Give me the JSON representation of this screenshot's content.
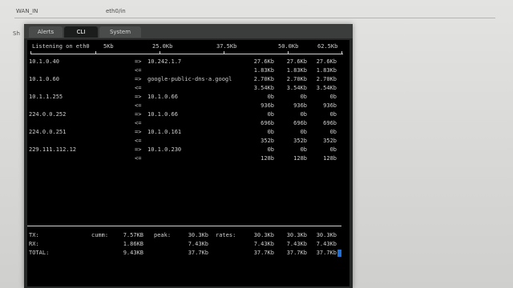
{
  "background": {
    "tab_left": "WAN_IN",
    "tab_right": "eth0/in",
    "side_text": "Sh"
  },
  "tabs": [
    "Alerts",
    "CLI",
    "System"
  ],
  "terminal": {
    "header": "Listening on eth0",
    "scale": [
      "5Kb",
      "25.0Kb",
      "37.5Kb",
      "50.0Kb",
      "62.5Kb"
    ],
    "flows": [
      {
        "src": "10.1.0.40",
        "dst": "10.242.1.7",
        "out": [
          "27.6Kb",
          "27.6Kb",
          "27.6Kb"
        ],
        "in": [
          "1.83Kb",
          "1.83Kb",
          "1.83Kb"
        ]
      },
      {
        "src": "10.1.0.60",
        "dst": "google-public-dns-a.googl",
        "out": [
          "2.70Kb",
          "2.70Kb",
          "2.70Kb"
        ],
        "in": [
          "3.54Kb",
          "3.54Kb",
          "3.54Kb"
        ]
      },
      {
        "src": "10.1.1.255",
        "dst": "10.1.0.66",
        "out": [
          "0b",
          "0b",
          "0b"
        ],
        "in": [
          "936b",
          "936b",
          "936b"
        ]
      },
      {
        "src": "224.0.0.252",
        "dst": "10.1.0.66",
        "out": [
          "0b",
          "0b",
          "0b"
        ],
        "in": [
          "696b",
          "696b",
          "696b"
        ]
      },
      {
        "src": "224.0.0.251",
        "dst": "10.1.0.161",
        "out": [
          "0b",
          "0b",
          "0b"
        ],
        "in": [
          "352b",
          "352b",
          "352b"
        ]
      },
      {
        "src": "229.111.112.12",
        "dst": "10.1.0.230",
        "out": [
          "0b",
          "0b",
          "0b"
        ],
        "in": [
          "128b",
          "128b",
          "128b"
        ]
      }
    ],
    "arrows": {
      "out": "=>",
      "in": "<="
    },
    "totals": {
      "tx_label": "TX:",
      "rx_label": "RX:",
      "total_label": "TOTAL:",
      "cumm_label": "cumm:",
      "peak_label": "peak:",
      "rates_label": "rates:",
      "tx_cumm": "7.57KB",
      "rx_cumm": "1.86KB",
      "total_cumm": "9.43KB",
      "tx_peak": "30.3Kb",
      "rx_peak": "7.43Kb",
      "total_peak": "37.7Kb",
      "tx_rates": [
        "30.3Kb",
        "30.3Kb",
        "30.3Kb"
      ],
      "rx_rates": [
        "7.43Kb",
        "7.43Kb",
        "7.43Kb"
      ],
      "total_rates": [
        "37.7Kb",
        "37.7Kb",
        "37.7Kb"
      ]
    }
  },
  "colors": {
    "cursor": "#1e6fd8",
    "terminal_bg": "#000000",
    "terminal_text": "#cfcfcf"
  }
}
